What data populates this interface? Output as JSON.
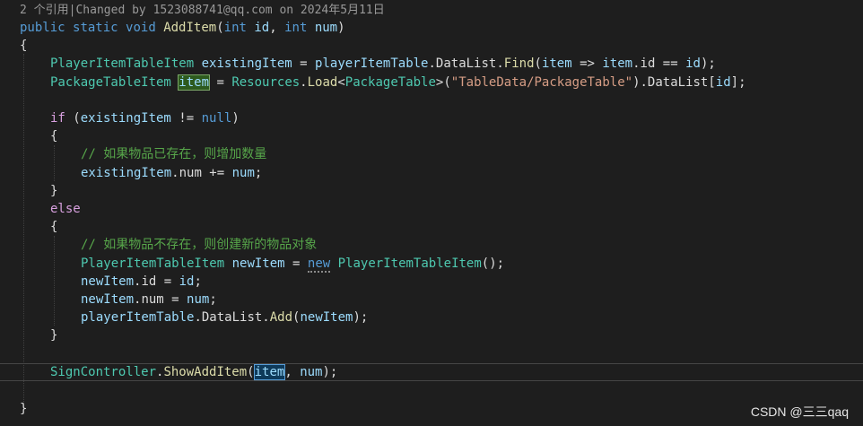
{
  "codelens": "2 个引用|Changed by 1523088741@qq.com on 2024年5月11日",
  "code": {
    "sig_public": "public",
    "sig_static": "static",
    "sig_void": "void",
    "sig_name": "AddItem",
    "sig_open": "(",
    "sig_int1": "int",
    "sig_p1": "id",
    "sig_comma": ", ",
    "sig_int2": "int",
    "sig_p2": "num",
    "sig_close": ")",
    "open_brace": "{",
    "l1_type": "PlayerItemTableItem",
    "l1_var": "existingItem",
    "l1_eq": " = ",
    "l1_table": "playerItemTable",
    "l1_dot": ".DataList.",
    "l1_find": "Find",
    "l1_paren": "(",
    "l1_item": "item",
    "l1_arrow": " => ",
    "l1_item2": "item",
    "l1_id": ".id == ",
    "l1_idp": "id",
    "l1_end": ");",
    "l2_type": "PackageTableItem",
    "l2_item": "item",
    "l2_eq": " = ",
    "l2_res": "Resources",
    "l2_dot": ".",
    "l2_load": "Load",
    "l2_lt": "<",
    "l2_pt": "PackageTable",
    "l2_gt": ">(",
    "l2_str": "\"TableData/PackageTable\"",
    "l2_dl": ").DataList[",
    "l2_id": "id",
    "l2_end": "];",
    "if_kw": "if",
    "if_open": " (",
    "if_var": "existingItem",
    "if_ne": " != ",
    "if_null": "null",
    "if_close": ")",
    "brace_open2": "{",
    "cm1": "// 如果物品已存在，则增加数量",
    "l3_var": "existingItem",
    "l3_num": ".num += ",
    "l3_nump": "num",
    "l3_end": ";",
    "brace_close2": "}",
    "else_kw": "else",
    "brace_open3": "{",
    "cm2": "// 如果物品不存在，则创建新的物品对象",
    "l4_type": "PlayerItemTableItem",
    "l4_var": "newItem",
    "l4_eq": " = ",
    "l4_new": "new",
    "l4_sp": " ",
    "l4_ctor": "PlayerItemTableItem",
    "l4_end": "();",
    "l5_var": "newItem",
    "l5_mid": ".id = ",
    "l5_id": "id",
    "l5_end": ";",
    "l6_var": "newItem",
    "l6_mid": ".num = ",
    "l6_num": "num",
    "l6_end": ";",
    "l7_table": "playerItemTable",
    "l7_dl": ".DataList.",
    "l7_add": "Add",
    "l7_open": "(",
    "l7_var": "newItem",
    "l7_end": ");",
    "brace_close3": "}",
    "l8_type": "SignController",
    "l8_dot": ".",
    "l8_fn": "ShowAddItem",
    "l8_open": "(",
    "l8_item": "item",
    "l8_comma": ", ",
    "l8_num": "num",
    "l8_end": ");",
    "close_brace": "}"
  },
  "watermark": "CSDN @三三qaq"
}
